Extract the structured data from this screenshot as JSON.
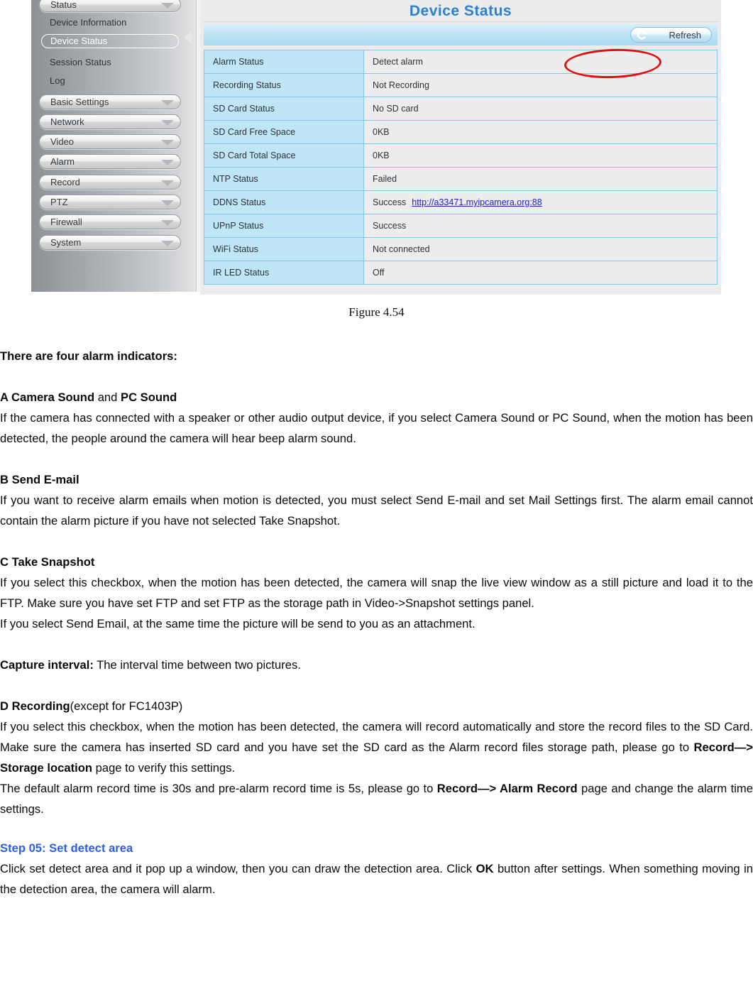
{
  "figure": {
    "caption": "Figure 4.54",
    "sidebar": {
      "menu_buttons": [
        {
          "label": "Status",
          "icon": "chevron-down-icon"
        },
        {
          "label": "Basic Settings",
          "icon": "chevron-down-icon"
        },
        {
          "label": "Network",
          "icon": "chevron-down-icon"
        },
        {
          "label": "Video",
          "icon": "chevron-down-icon"
        },
        {
          "label": "Alarm",
          "icon": "chevron-down-icon"
        },
        {
          "label": "Record",
          "icon": "chevron-down-icon"
        },
        {
          "label": "PTZ",
          "icon": "chevron-down-icon"
        },
        {
          "label": "Firewall",
          "icon": "chevron-down-icon"
        },
        {
          "label": "System",
          "icon": "chevron-down-icon"
        }
      ],
      "sub_items": [
        {
          "label": "Device Information",
          "selected": false
        },
        {
          "label": "Device Status",
          "selected": true
        },
        {
          "label": "Session Status",
          "selected": false
        },
        {
          "label": "Log",
          "selected": false
        }
      ]
    },
    "main": {
      "title": "Device Status",
      "refresh_label": "Refresh",
      "refresh_icon": "refresh-arrow-icon",
      "rows": [
        {
          "key": "Alarm Status",
          "value": "Detect alarm"
        },
        {
          "key": "Recording Status",
          "value": "Not Recording"
        },
        {
          "key": "SD Card Status",
          "value": "No SD card"
        },
        {
          "key": "SD Card Free Space",
          "value": "0KB"
        },
        {
          "key": "SD Card Total Space",
          "value": "0KB"
        },
        {
          "key": "NTP Status",
          "value": "Failed"
        },
        {
          "key": "DDNS Status",
          "value": "Success",
          "link": "http://a33471.myipcamera.org:88"
        },
        {
          "key": "UPnP Status",
          "value": "Success"
        },
        {
          "key": "WiFi Status",
          "value": "Not connected"
        },
        {
          "key": "IR LED Status",
          "value": "Off"
        }
      ]
    },
    "annotation": {
      "shape": "red-ellipse",
      "color": "#e11010",
      "targets": "Detect alarm"
    }
  },
  "body": {
    "intro_heading": "There are four alarm indicators:",
    "a_head_1": "A Camera Sound",
    "a_head_mid": " and ",
    "a_head_2": "PC Sound",
    "a_para": "If the camera has connected with a speaker or other audio output device, if you select Camera Sound or PC Sound, when the motion has been detected, the people around the camera will hear beep alarm sound.",
    "b_head": "B Send E-mail",
    "b_para": "If you want to receive alarm emails when motion is detected, you must select Send E-mail and set Mail Settings first. The alarm email cannot contain the alarm picture if you have not selected Take Snapshot.",
    "c_head": "C Take Snapshot",
    "c_para": "If you select this checkbox, when the motion has been detected, the camera will snap the live view window as a still picture and load it to the FTP. Make sure you have set FTP and set FTP as the storage path in Video->Snapshot settings panel.",
    "c_para2": "If you select Send Email, at the same time the picture will be send to you as an attachment.",
    "capture_label": "Capture interval:",
    "capture_text": " The interval time between two pictures.",
    "d_head": "D Recording",
    "d_head_note": "(except for FC1403P)",
    "d_para_1": "If you select this checkbox, when the motion has been detected, the camera will record automatically and store the record files to the SD Card.    Make sure the camera has inserted SD card and you have set the SD card as the Alarm record files storage path, please go to ",
    "d_bold_1": "Record—> Storage location",
    "d_para_2": " page to verify this settings.",
    "d_para_3": "The default alarm record time is 30s and pre-alarm record time is 5s, please go to ",
    "d_bold_2": "Record—> Alarm Record",
    "d_para_4": " page and change the alarm time settings.",
    "step_head": "Step 05: Set detect area",
    "step_para_1": "Click set detect area and it pop up a window, then you can draw the detection area. Click ",
    "step_bold": "OK",
    "step_para_2": " button after settings. When something moving in the detection area, the camera will alarm."
  }
}
